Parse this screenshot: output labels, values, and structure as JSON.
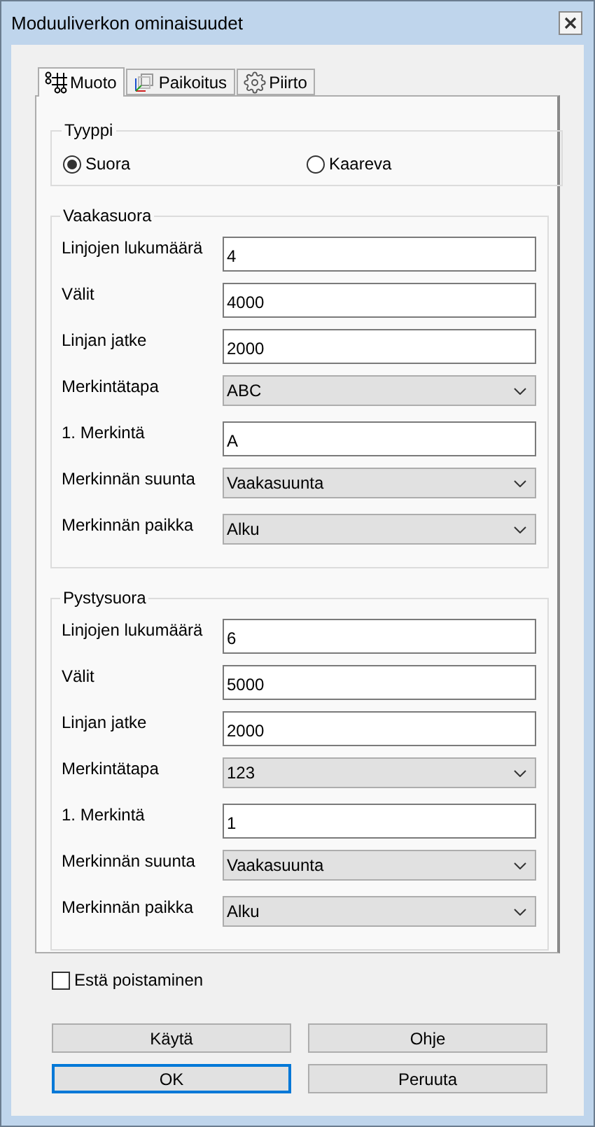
{
  "window": {
    "title": "Moduuliverkon ominaisuudet"
  },
  "tabs": [
    {
      "label": "Muoto",
      "kind": "grid",
      "selected": true
    },
    {
      "label": "Paikoitus",
      "kind": "axes",
      "selected": false
    },
    {
      "label": "Piirto",
      "kind": "gear",
      "selected": false
    }
  ],
  "type_group": {
    "title": "Tyyppi",
    "options": [
      {
        "label": "Suora",
        "selected": true
      },
      {
        "label": "Kaareva",
        "selected": false
      }
    ]
  },
  "sections": [
    {
      "title": "Vaakasuora",
      "rows": [
        {
          "kind": "input",
          "label": "Linjojen lukumäärä",
          "value": "4"
        },
        {
          "kind": "input",
          "label": "Välit",
          "value": "4000"
        },
        {
          "kind": "input",
          "label": "Linjan jatke",
          "value": "2000"
        },
        {
          "kind": "select",
          "label": "Merkintätapa",
          "value": "ABC"
        },
        {
          "kind": "input",
          "label": "1. Merkintä",
          "value": "A"
        },
        {
          "kind": "select",
          "label": "Merkinnän suunta",
          "value": "Vaakasuunta"
        },
        {
          "kind": "select",
          "label": "Merkinnän paikka",
          "value": "Alku"
        }
      ]
    },
    {
      "title": "Pystysuora",
      "rows": [
        {
          "kind": "input",
          "label": "Linjojen lukumäärä",
          "value": "6"
        },
        {
          "kind": "input",
          "label": "Välit",
          "value": "5000"
        },
        {
          "kind": "input",
          "label": "Linjan jatke",
          "value": "2000"
        },
        {
          "kind": "select",
          "label": "Merkintätapa",
          "value": "123"
        },
        {
          "kind": "input",
          "label": "1. Merkintä",
          "value": "1"
        },
        {
          "kind": "select",
          "label": "Merkinnän suunta",
          "value": "Vaakasuunta"
        },
        {
          "kind": "select",
          "label": "Merkinnän paikka",
          "value": "Alku"
        }
      ]
    }
  ],
  "prevent_delete": {
    "label": "Estä poistaminen",
    "checked": false
  },
  "buttons": [
    {
      "label": "Käytä",
      "default": false
    },
    {
      "label": "Ohje",
      "default": false
    },
    {
      "label": "OK",
      "default": true
    },
    {
      "label": "Peruuta",
      "default": false
    }
  ]
}
